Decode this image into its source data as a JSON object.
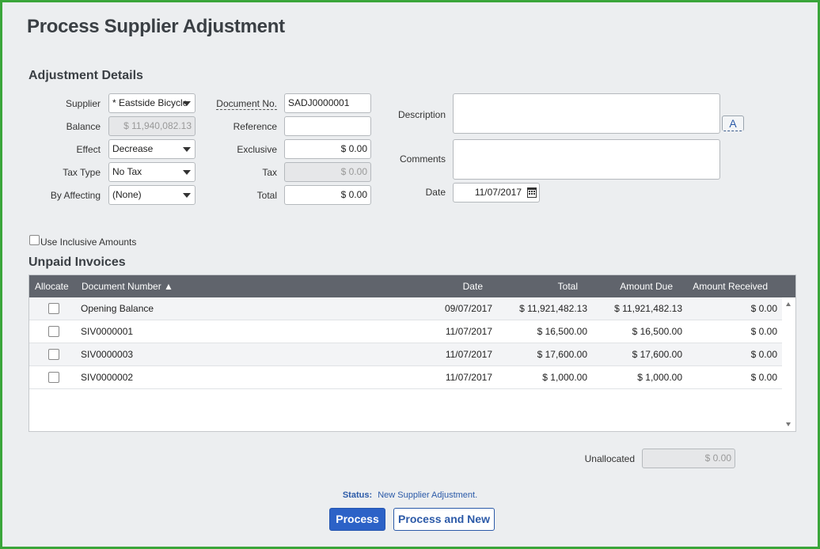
{
  "page": {
    "title": "Process Supplier Adjustment"
  },
  "details": {
    "section_title": "Adjustment Details",
    "supplier": {
      "label": "Supplier",
      "value": "* Eastside Bicycle"
    },
    "balance": {
      "label": "Balance",
      "value": "$ 11,940,082.13"
    },
    "effect": {
      "label": "Effect",
      "value": "Decrease"
    },
    "tax_type": {
      "label": "Tax Type",
      "value": "No Tax"
    },
    "by_affecting": {
      "label": "By Affecting",
      "value": "(None)"
    },
    "document_no": {
      "label": "Document No.",
      "value": "SADJ0000001"
    },
    "reference": {
      "label": "Reference",
      "value": ""
    },
    "exclusive": {
      "label": "Exclusive",
      "value": "$ 0.00"
    },
    "tax": {
      "label": "Tax",
      "value": "$ 0.00"
    },
    "total": {
      "label": "Total",
      "value": "$ 0.00"
    },
    "description": {
      "label": "Description",
      "value": ""
    },
    "comments": {
      "label": "Comments",
      "value": ""
    },
    "date": {
      "label": "Date",
      "value": "11/07/2017"
    },
    "spell_button": "A",
    "inclusive_label": "Use Inclusive Amounts"
  },
  "invoices": {
    "section_title": "Unpaid Invoices",
    "columns": [
      "Allocate",
      "Document Number ▲",
      "Date",
      "Total",
      "Amount Due",
      "Amount Received"
    ],
    "rows": [
      {
        "document": "Opening Balance",
        "date": "09/07/2017",
        "total": "$ 11,921,482.13",
        "due": "$ 11,921,482.13",
        "received": "$ 0.00"
      },
      {
        "document": "SIV0000001",
        "date": "11/07/2017",
        "total": "$ 16,500.00",
        "due": "$ 16,500.00",
        "received": "$ 0.00"
      },
      {
        "document": "SIV0000003",
        "date": "11/07/2017",
        "total": "$ 17,600.00",
        "due": "$ 17,600.00",
        "received": "$ 0.00"
      },
      {
        "document": "SIV0000002",
        "date": "11/07/2017",
        "total": "$ 1,000.00",
        "due": "$ 1,000.00",
        "received": "$ 0.00"
      }
    ]
  },
  "unallocated": {
    "label": "Unallocated",
    "value": "$ 0.00"
  },
  "status": {
    "label": "Status:",
    "text": "New Supplier Adjustment."
  },
  "actions": {
    "process": "Process",
    "process_and_new": "Process and New"
  },
  "colors": {
    "accent": "#2c62c7",
    "header_bg": "#60646c",
    "frame": "#3aa53a"
  }
}
